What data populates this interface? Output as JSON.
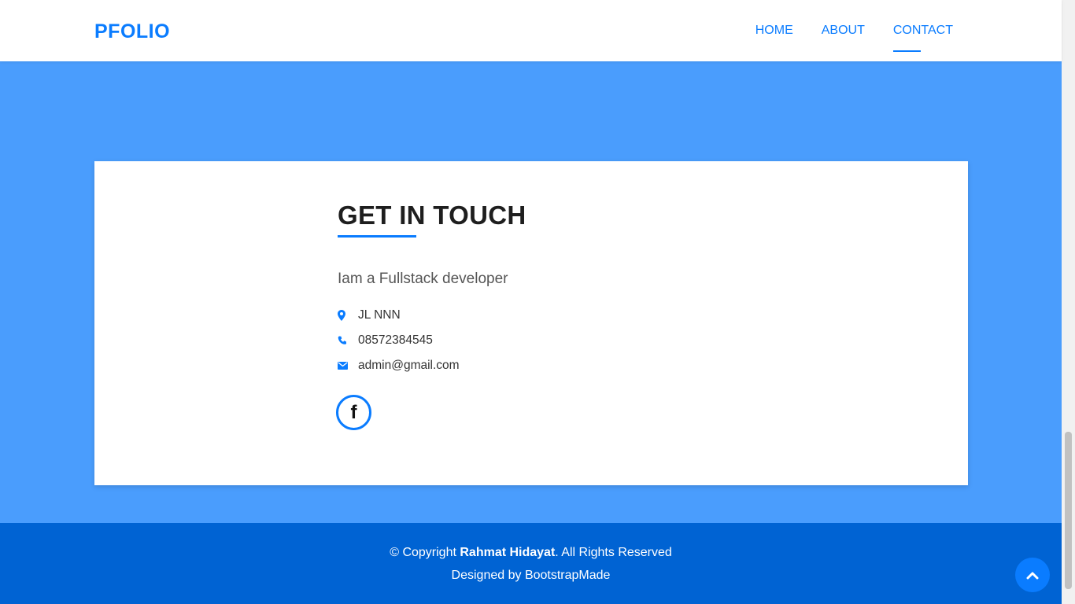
{
  "nav": {
    "brand": "PFOLIO",
    "links": [
      {
        "label": "HOME",
        "active": false
      },
      {
        "label": "ABOUT",
        "active": false
      },
      {
        "label": "CONTACT",
        "active": true
      }
    ]
  },
  "contact": {
    "title": "GET IN TOUCH",
    "lead": "Iam a Fullstack developer",
    "address": "JL NNN",
    "phone": "08572384545",
    "email": "admin@gmail.com",
    "social": [
      {
        "icon": "facebook-icon",
        "glyph": "f"
      }
    ]
  },
  "footer": {
    "copyright_prefix": "© Copyright ",
    "owner": "Rahmat Hidayat",
    "copyright_suffix": ". All Rights Reserved",
    "credit": "Designed by BootstrapMade"
  },
  "colors": {
    "accent": "#0a7cff",
    "hero_bg": "#4a9dfd",
    "footer_bg": "#0063d3",
    "card_bg": "#ffffff"
  },
  "icons": {
    "address": "map-pin-icon",
    "phone": "phone-icon",
    "email": "envelope-icon",
    "back_to_top": "chevron-up-icon"
  }
}
